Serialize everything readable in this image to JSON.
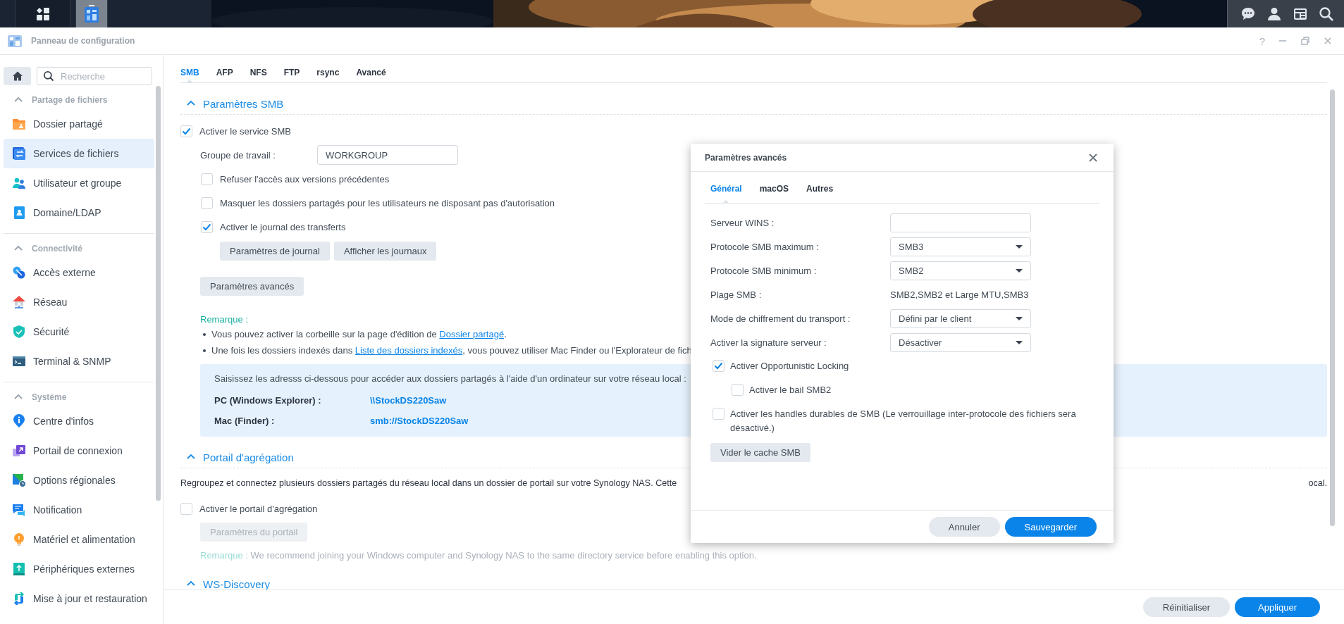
{
  "taskbar": {
    "buttons": [
      {
        "kind": "main-menu",
        "selected": false
      },
      {
        "kind": "control-panel",
        "selected": true
      }
    ],
    "tray": [
      {
        "kind": "chat"
      },
      {
        "kind": "user"
      },
      {
        "kind": "widgets"
      },
      {
        "kind": "search"
      }
    ]
  },
  "window": {
    "title": "Panneau de configuration",
    "help": "?"
  },
  "sidebar": {
    "search": {
      "placeholder": "Recherche"
    },
    "sections": [
      {
        "title": "Partage de fichiers",
        "expanded": true,
        "items": [
          {
            "label": "Dossier partagé",
            "kind": "folder",
            "selected": false
          },
          {
            "label": "Services de fichiers",
            "kind": "files",
            "selected": true
          },
          {
            "label": "Utilisateur et groupe",
            "kind": "users",
            "selected": false
          },
          {
            "label": "Domaine/LDAP",
            "kind": "domain",
            "selected": false
          }
        ]
      },
      {
        "title": "Connectivité",
        "expanded": true,
        "items": [
          {
            "label": "Accès externe",
            "kind": "external",
            "selected": false
          },
          {
            "label": "Réseau",
            "kind": "network",
            "selected": false
          },
          {
            "label": "Sécurité",
            "kind": "security",
            "selected": false
          },
          {
            "label": "Terminal & SNMP",
            "kind": "terminal",
            "selected": false
          }
        ]
      },
      {
        "title": "Système",
        "expanded": true,
        "items": [
          {
            "label": "Centre d'infos",
            "kind": "info",
            "selected": false
          },
          {
            "label": "Portail de connexion",
            "kind": "portal",
            "selected": false
          },
          {
            "label": "Options régionales",
            "kind": "regional",
            "selected": false
          },
          {
            "label": "Notification",
            "kind": "notification",
            "selected": false
          },
          {
            "label": "Matériel et alimentation",
            "kind": "hardware",
            "selected": false
          },
          {
            "label": "Périphériques externes",
            "kind": "devices",
            "selected": false
          },
          {
            "label": "Mise à jour et restauration",
            "kind": "update",
            "selected": false
          }
        ]
      }
    ]
  },
  "tabs": [
    {
      "label": "SMB",
      "selected": true
    },
    {
      "label": "AFP",
      "selected": false
    },
    {
      "label": "NFS",
      "selected": false
    },
    {
      "label": "FTP",
      "selected": false
    },
    {
      "label": "rsync",
      "selected": false
    },
    {
      "label": "Avancé",
      "selected": false
    }
  ],
  "smb_section": {
    "title": "Paramètres SMB",
    "expanded": true,
    "enable": {
      "label": "Activer le service SMB",
      "checked": true
    },
    "workgroup": {
      "label": "Groupe de travail :",
      "value": "WORKGROUP"
    },
    "options": [
      {
        "label": "Refuser l'accès aux versions précédentes",
        "checked": false
      },
      {
        "label": "Masquer les dossiers partagés pour les utilisateurs ne disposant pas d'autorisation",
        "checked": false
      },
      {
        "label": "Activer le journal des transferts",
        "checked": true,
        "buttons": [
          "Paramètres de journal",
          "Afficher les journaux"
        ]
      }
    ],
    "advanced_button": "Paramètres avancés",
    "note": {
      "title": "Remarque :",
      "disabled": false,
      "bullets": [
        {
          "before": "Vous pouvez activer la corbeille sur la page d'édition de ",
          "link": "Dossier partagé",
          "after": "."
        },
        {
          "before": "Une fois les dossiers indexés dans ",
          "link": "Liste des dossiers indexés",
          "after": ", vous pouvez utiliser Mac Finder ou l'Explorateur de fich"
        }
      ]
    },
    "address_box": {
      "intro": "Saisissez les adresss ci-dessous pour accéder aux dossiers partagés à l'aide d'un ordinateur sur votre réseau local :",
      "rows": [
        {
          "label": "PC (Windows Explorer) :",
          "value": "\\\\StockDS220Saw"
        },
        {
          "label": "Mac (Finder) :",
          "value": "smb://StockDS220Saw"
        }
      ]
    }
  },
  "portal_section": {
    "title": "Portail d'agrégation",
    "expanded": true,
    "description": "Regroupez et connectez plusieurs dossiers partagés du réseau local dans un dossier de portail sur votre Synology NAS. Cette",
    "description_end": "ocal.",
    "enable": {
      "label": "Activer le portail d'agrégation",
      "checked": false
    },
    "button": {
      "label": "Paramètres du portail",
      "disabled": true
    },
    "note": {
      "title": "Remarque :",
      "text": "We recommend joining your Windows computer and Synology NAS to the same directory service before enabling this option.",
      "disabled": true
    }
  },
  "ws_section": {
    "title": "WS-Discovery",
    "expanded": true
  },
  "footer_buttons": [
    {
      "label": "Réinitialiser",
      "kind": "secondary"
    },
    {
      "label": "Appliquer",
      "kind": "primary"
    }
  ],
  "dialog": {
    "title": "Paramètres avancés",
    "tabs": [
      {
        "label": "Général",
        "selected": true
      },
      {
        "label": "macOS",
        "selected": false
      },
      {
        "label": "Autres",
        "selected": false
      }
    ],
    "fields": [
      {
        "kind": "input",
        "label": "Serveur WINS :"
      },
      {
        "kind": "select",
        "label": "Protocole SMB maximum :",
        "value": "SMB3"
      },
      {
        "kind": "select",
        "label": "Protocole SMB minimum :",
        "value": "SMB2"
      },
      {
        "kind": "static",
        "label": "Plage SMB :",
        "value": "SMB2,SMB2 et Large MTU,SMB3"
      },
      {
        "kind": "select",
        "label": "Mode de chiffrement du transport :",
        "value": "Défini par le client"
      },
      {
        "kind": "select",
        "label": "Activer la signature serveur :",
        "value": "Désactiver"
      }
    ],
    "checkboxes": [
      {
        "label": "Activer Opportunistic Locking",
        "checked": true,
        "children": [
          {
            "label": "Activer le bail SMB2",
            "checked": false
          }
        ]
      },
      {
        "label": "Activer les handles durables de SMB (Le verrouillage inter-protocole des fichiers sera désactivé.)",
        "checked": false
      }
    ],
    "button": "Vider le cache SMB",
    "footer_buttons": [
      {
        "label": "Annuler",
        "kind": "secondary"
      },
      {
        "label": "Sauvegarder",
        "kind": "primary"
      }
    ]
  }
}
